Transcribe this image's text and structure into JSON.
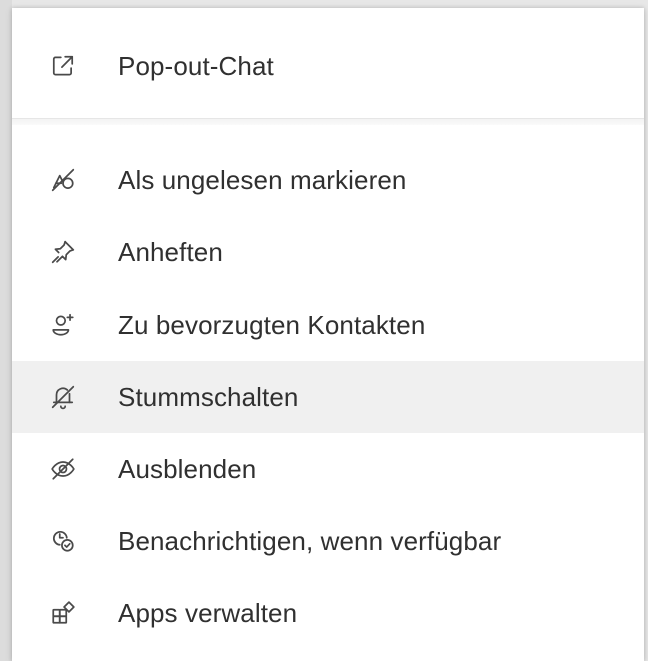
{
  "menu": {
    "items": [
      {
        "label": "Pop-out-Chat",
        "icon": "pop-out-icon"
      },
      {
        "label": "Als ungelesen markieren",
        "icon": "mark-unread-icon"
      },
      {
        "label": "Anheften",
        "icon": "pin-icon"
      },
      {
        "label": "Zu bevorzugten Kontakten",
        "icon": "add-favorite-contact-icon"
      },
      {
        "label": "Stummschalten",
        "icon": "mute-bell-icon"
      },
      {
        "label": "Ausblenden",
        "icon": "hide-eye-icon"
      },
      {
        "label": "Benachrichtigen, wenn verfügbar",
        "icon": "notify-available-icon"
      },
      {
        "label": "Apps verwalten",
        "icon": "manage-apps-icon"
      }
    ],
    "highlighted_item": "Stummschalten"
  },
  "colors": {
    "menu_background": "#ffffff",
    "highlight_background": "#f0f0f0",
    "text": "#303030",
    "icon_stroke": "#4a4a4a"
  }
}
